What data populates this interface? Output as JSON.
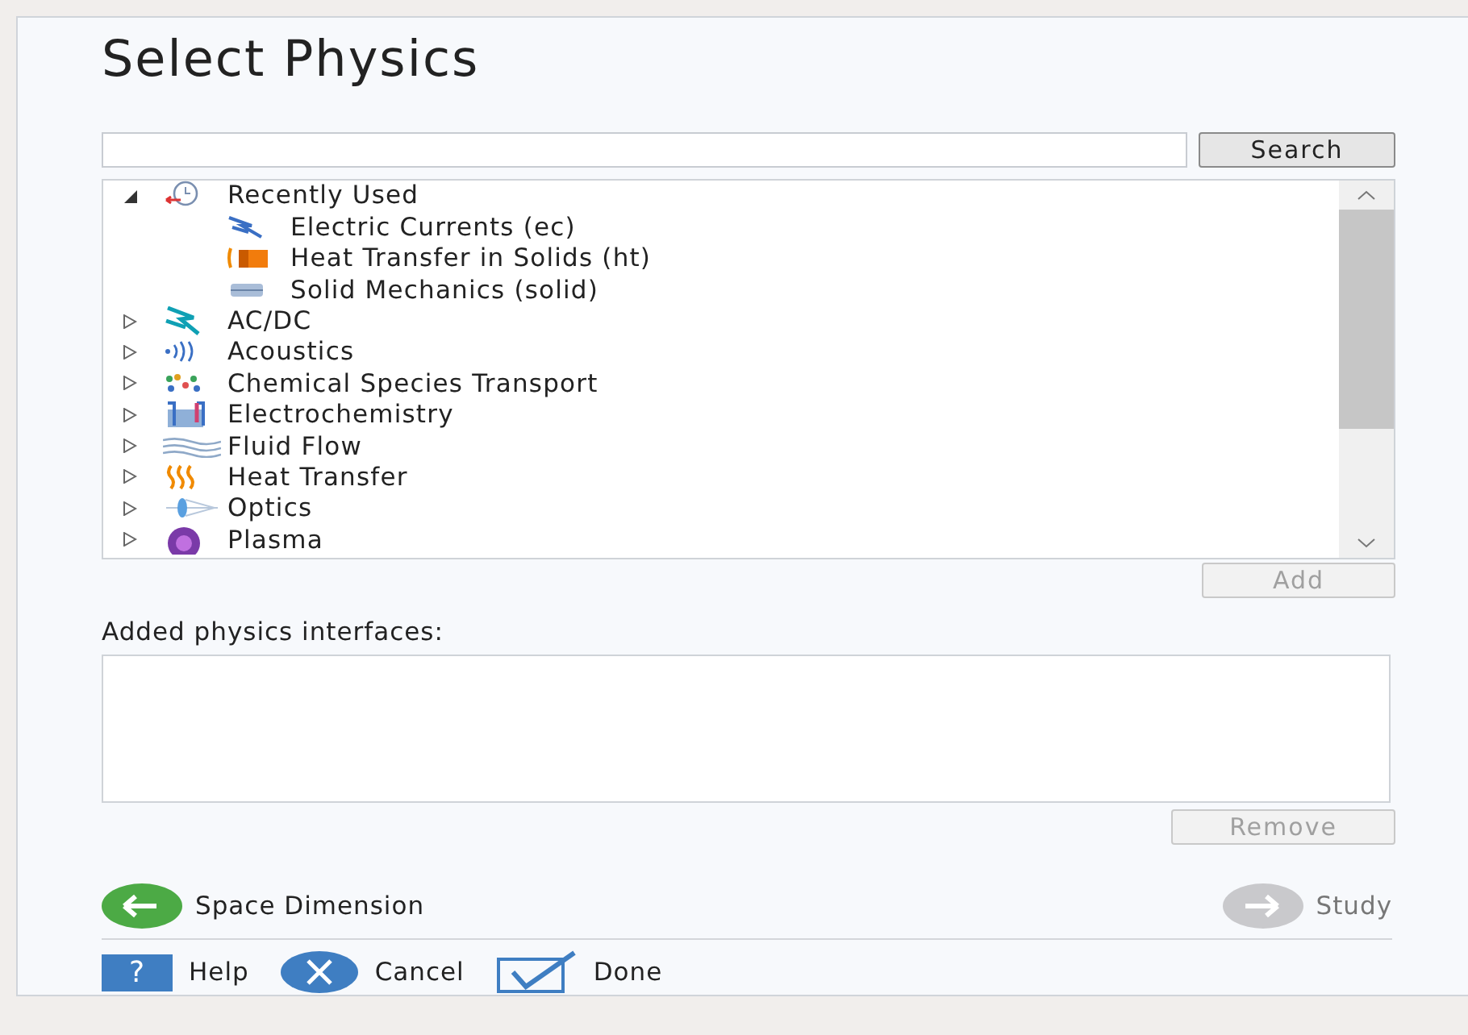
{
  "title": "Select Physics",
  "search": {
    "button": "Search"
  },
  "tree": [
    {
      "label": "Recently Used",
      "expanded": true,
      "children": [
        {
          "label": "Electric Currents (ec)"
        },
        {
          "label": "Heat Transfer in Solids (ht)"
        },
        {
          "label": "Solid Mechanics (solid)"
        }
      ]
    },
    {
      "label": "AC/DC",
      "expanded": false
    },
    {
      "label": "Acoustics",
      "expanded": false
    },
    {
      "label": "Chemical Species Transport",
      "expanded": false
    },
    {
      "label": "Electrochemistry",
      "expanded": false
    },
    {
      "label": "Fluid Flow",
      "expanded": false
    },
    {
      "label": "Heat Transfer",
      "expanded": false
    },
    {
      "label": "Optics",
      "expanded": false
    },
    {
      "label": "Plasma",
      "expanded": false
    }
  ],
  "add_button": {
    "label": "Add",
    "disabled": true
  },
  "added_label": "Added physics interfaces:",
  "remove_button": {
    "label": "Remove",
    "disabled": true
  },
  "navigation": [
    {
      "label": "Space Dimension",
      "kind": "back",
      "disabled": false
    },
    {
      "label": "Study",
      "kind": "forward",
      "disabled": true
    }
  ],
  "actions": [
    {
      "label": "Help",
      "kind": "help",
      "icon": "?"
    },
    {
      "label": "Cancel",
      "kind": "cancel"
    },
    {
      "label": "Done",
      "kind": "done"
    }
  ]
}
